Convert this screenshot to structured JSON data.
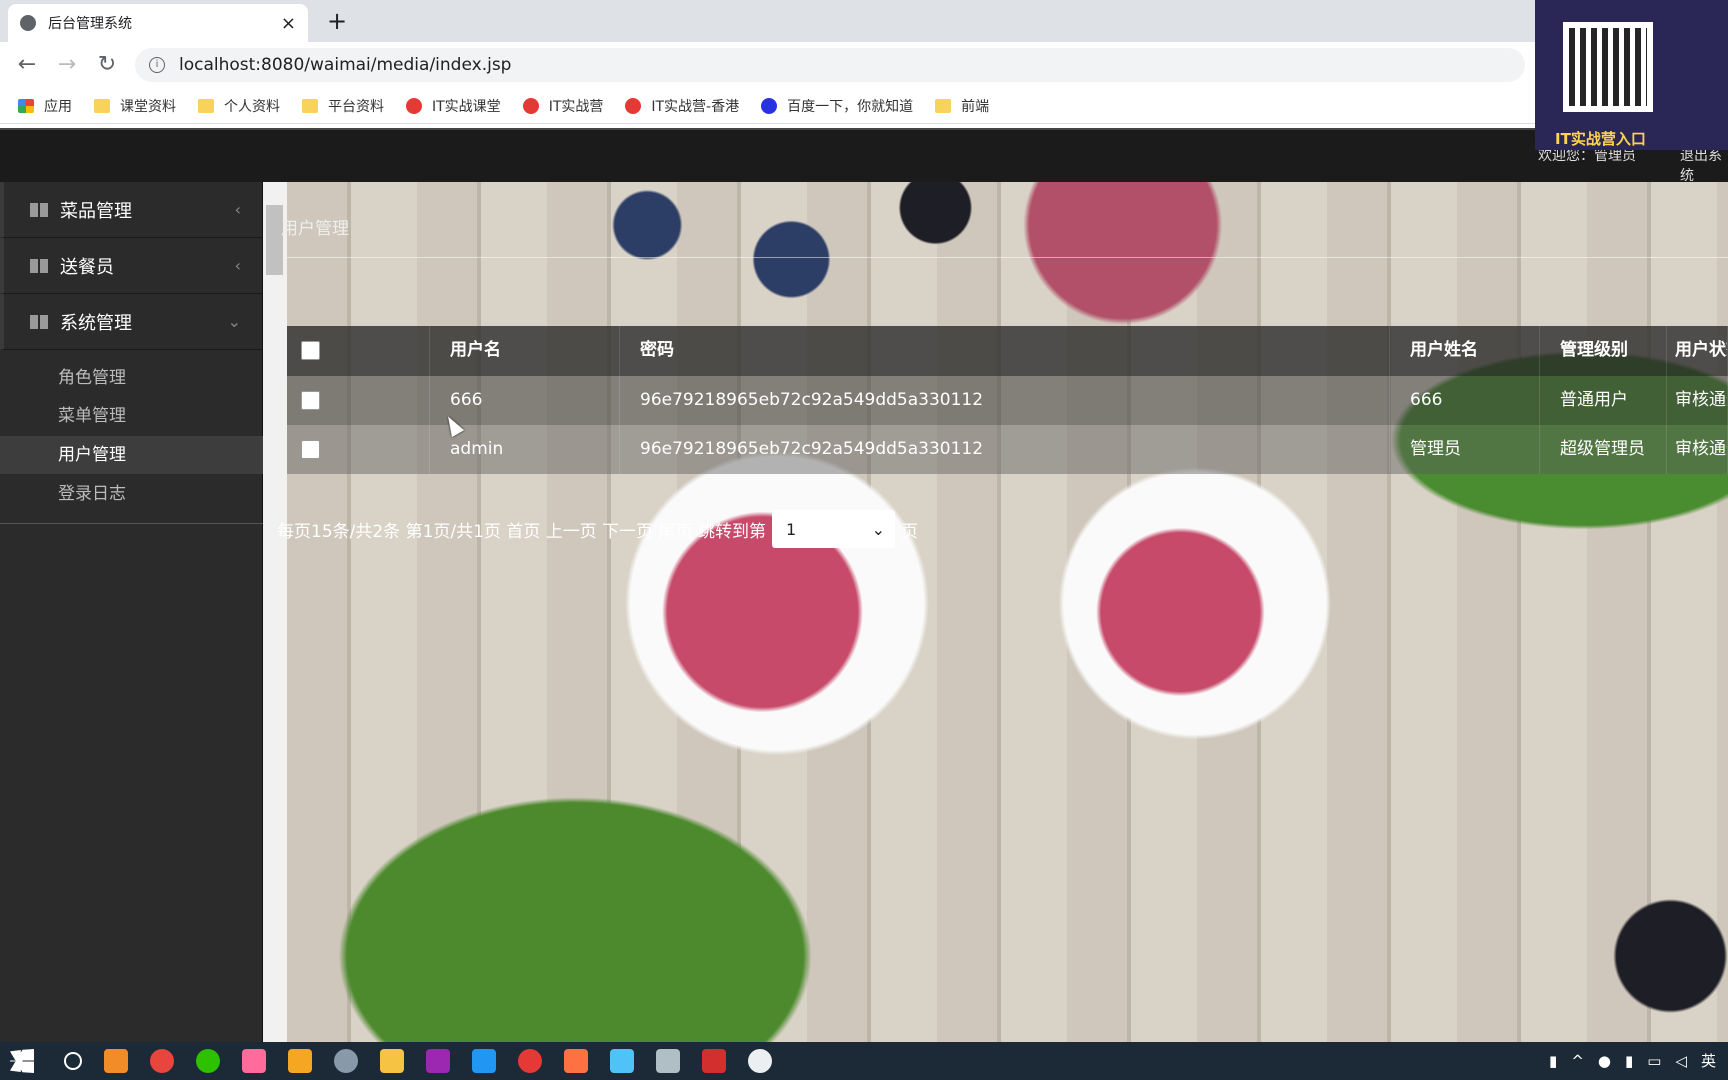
{
  "browser": {
    "tab_title": "后台管理系统",
    "tab_close": "×",
    "new_tab": "+",
    "url": "localhost:8080/waimai/media/index.jsp",
    "bookmarks": [
      {
        "label": "应用",
        "icon": "apps-icon"
      },
      {
        "label": "课堂资料",
        "icon": "folder-icon"
      },
      {
        "label": "个人资料",
        "icon": "folder-icon"
      },
      {
        "label": "平台资料",
        "icon": "folder-icon"
      },
      {
        "label": "IT实战课堂",
        "icon": "site-icon"
      },
      {
        "label": "IT实战营",
        "icon": "site-icon"
      },
      {
        "label": "IT实战营-香港",
        "icon": "site-icon"
      },
      {
        "label": "百度一下，你就知道",
        "icon": "baidu-icon"
      },
      {
        "label": "前端",
        "icon": "folder-icon"
      }
    ]
  },
  "overlay": {
    "qr_label": "IT实战营入口"
  },
  "header": {
    "welcome": "欢迎您：管理员",
    "logout": "退出系统"
  },
  "sidebar": {
    "menus": [
      {
        "label": "菜品管理",
        "chevron": "‹"
      },
      {
        "label": "送餐员",
        "chevron": "‹"
      },
      {
        "label": "系统管理",
        "chevron": "⌄"
      }
    ],
    "submenu": [
      {
        "label": "角色管理",
        "active": false
      },
      {
        "label": "菜单管理",
        "active": false
      },
      {
        "label": "用户管理",
        "active": true
      },
      {
        "label": "登录日志",
        "active": false
      }
    ]
  },
  "main": {
    "breadcrumb": "用户管理",
    "table": {
      "headers": [
        "用户名",
        "密码",
        "用户姓名",
        "管理级别",
        "用户状态"
      ],
      "rows": [
        [
          "666",
          "96e79218965eb72c92a549dd5a330112",
          "666",
          "普通用户",
          "审核通过"
        ],
        [
          "admin",
          "96e79218965eb72c92a549dd5a330112",
          "管理员",
          "超级管理员",
          "审核通过"
        ]
      ]
    },
    "pager": {
      "text": "每页15条/共2条 第1页/共1页 首页 上一页 下一页 尾页 跳转到第",
      "select_value": "1",
      "suffix": "页"
    }
  }
}
